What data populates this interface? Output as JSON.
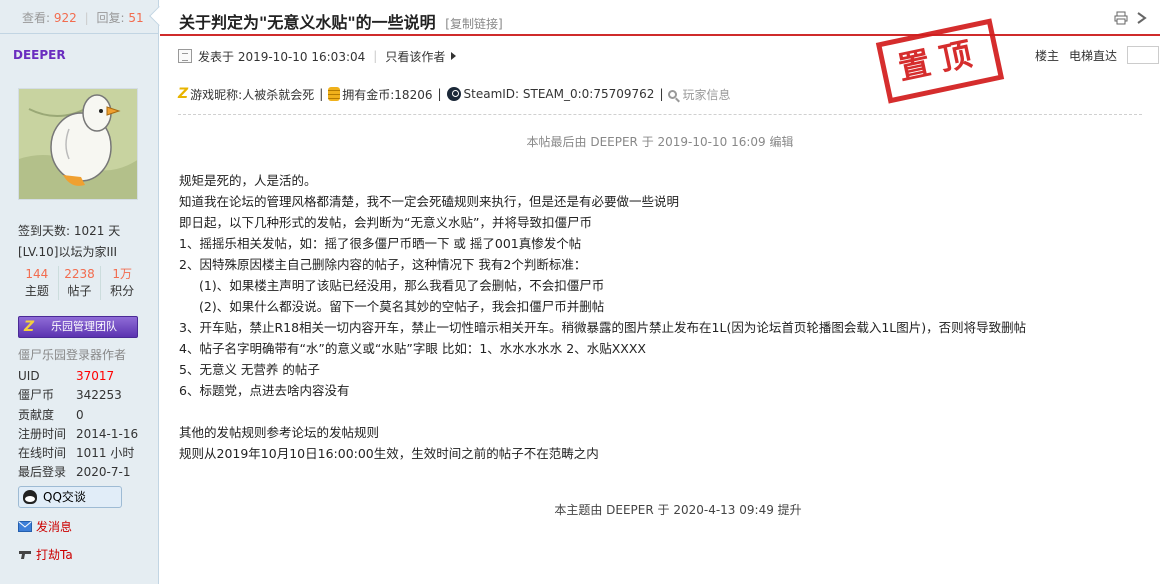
{
  "sidebar": {
    "views_label": "查看:",
    "views": "922",
    "replies_label": "回复:",
    "replies": "51",
    "author": "DEEPER",
    "signin_days": "签到天数: 1021 天",
    "level": "[LV.10]以坛为家III",
    "stats": [
      {
        "value": "144",
        "label": "主题"
      },
      {
        "value": "2238",
        "label": "帖子"
      },
      {
        "value": "1万",
        "label": "积分"
      }
    ],
    "team_badge": "乐园管理团队",
    "team_badge_logo": "Z",
    "custom_title": "僵尸乐园登录器作者",
    "profile": [
      {
        "key": "UID",
        "value": "37017",
        "highlight": true
      },
      {
        "key": "僵尸币",
        "value": "342253",
        "highlight": false
      },
      {
        "key": "贡献度",
        "value": "0",
        "highlight": false
      },
      {
        "key": "注册时间",
        "value": "2014-1-16",
        "highlight": false
      },
      {
        "key": "在线时间",
        "value": "1011 小时",
        "highlight": false
      },
      {
        "key": "最后登录",
        "value": "2020-7-1",
        "highlight": false
      }
    ],
    "qq_button": "QQ交谈",
    "send_message": "发消息",
    "hit_ta": "打劫Ta"
  },
  "header": {
    "title": "关于判定为\"无意义水贴\"的一些说明",
    "copy_link": "[复制链接]"
  },
  "post_meta": {
    "posted_at": "发表于 2019-10-10 16:03:04",
    "author_only": "只看该作者",
    "floor_label": "楼主",
    "elevator_label": "电梯直达",
    "stamp": "置顶"
  },
  "game_info": {
    "nickname": "游戏昵称:人被杀就会死",
    "coins": "拥有金币:18206",
    "steam_id": "SteamID: STEAM_0:0:75709762",
    "player_info": "玩家信息"
  },
  "edit_note": "本帖最后由 DEEPER 于 2019-10-10 16:09 编辑",
  "post_lines": [
    {
      "text": "规矩是死的，人是活的。",
      "indent": false
    },
    {
      "text": "知道我在论坛的管理风格都清楚，我不一定会死磕规则来执行，但是还是有必要做一些说明",
      "indent": false
    },
    {
      "text": "即日起，以下几种形式的发帖，会判断为“无意义水贴”，并将导致扣僵尸币",
      "indent": false
    },
    {
      "text": "1、摇摇乐相关发帖，如：摇了很多僵尸币晒一下 或 摇了001真惨发个帖",
      "indent": false
    },
    {
      "text": "2、因特殊原因楼主自己删除内容的帖子，这种情况下 我有2个判断标准：",
      "indent": false
    },
    {
      "text": "(1)、如果楼主声明了该贴已经没用，那么我看见了会删帖，不会扣僵尸币",
      "indent": true
    },
    {
      "text": "(2)、如果什么都没说。留下一个莫名其妙的空帖子，我会扣僵尸币并删帖",
      "indent": true
    },
    {
      "text": "3、开车贴，禁止R18相关一切内容开车，禁止一切性暗示相关开车。稍微暴露的图片禁止发布在1L(因为论坛首页轮播图会载入1L图片)，否则将导致删帖",
      "indent": false
    },
    {
      "text": "4、帖子名字明确带有“水”的意义或“水贴”字眼 比如：1、水水水水水 2、水贴XXXX",
      "indent": false
    },
    {
      "text": "5、无意义 无营养 的帖子",
      "indent": false
    },
    {
      "text": "6、标题党，点进去啥内容没有",
      "indent": false
    },
    {
      "text": "",
      "indent": false
    },
    {
      "text": "其他的发帖规则参考论坛的发帖规则",
      "indent": false
    },
    {
      "text": "规则从2019年10月10日16:00:00生效，生效时间之前的帖子不在范畴之内",
      "indent": false
    }
  ],
  "bump_note": "本主题由 DEEPER 于 2020-4-13 09:49 提升",
  "colors": {
    "accent_red": "#cf2b2b",
    "sidebar_bg": "#e5edf2",
    "author_purple": "#6a2dbf",
    "number_orange": "#f26c4f"
  }
}
